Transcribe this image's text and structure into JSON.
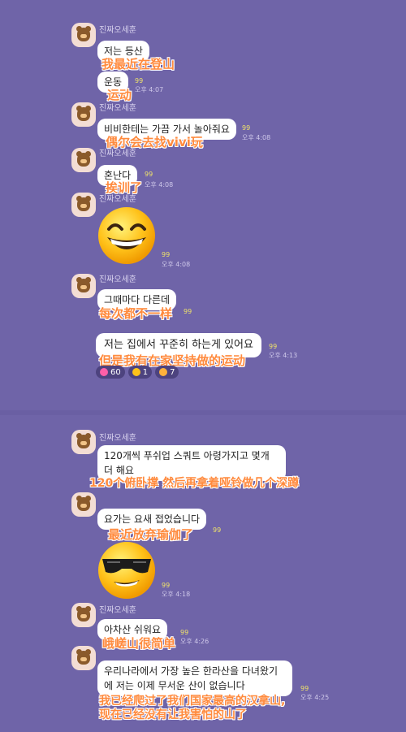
{
  "sender_name": "진짜오세훈",
  "read_mark": "99",
  "messages": [
    {
      "text": "저는 등산",
      "caption": "我最近在登山"
    },
    {
      "text": "운동",
      "time": "오후 4:07",
      "caption": "运动"
    },
    {
      "text": "비비한테는 가끔 가서 놀아줘요",
      "time": "오후 4:08",
      "caption": "偶尔会去找vivi玩"
    },
    {
      "text": "혼난다",
      "time": "오후 4:08",
      "caption": "挨训了"
    },
    {
      "emoji": "grinning-face",
      "time": "오후 4:08"
    },
    {
      "text": "그때마다 다른데",
      "caption": "每次都不一样"
    },
    {
      "text": "저는 집에서 꾸준히 하는게 있어요",
      "time": "오후 4:13",
      "caption": "但是我有在家坚持做的运动"
    },
    {
      "text": "120개씩 푸쉬업 스쿼트 아령가지고 몇개 더 해요",
      "caption": "120个俯卧撑 然后再拿着哑铃做几个深蹲"
    },
    {
      "text": "요가는 요새 접었습니다",
      "caption": "最近放弃瑜伽了"
    },
    {
      "emoji": "sunglasses-face",
      "time": "오후 4:18"
    },
    {
      "text": "아차산 쉬워요",
      "time": "오후 4:26",
      "caption": "峨嵯山很简单"
    },
    {
      "text": "우리나라에서 가장 높은 한라산을 다녀왔기에 저는 이제 무서운 산이 없습니다",
      "time": "오후 4:25",
      "caption": "我已经爬过了我们国家最高的汉拿山,\n现在已经没有让我害怕的山了"
    }
  ],
  "reactions": [
    {
      "icon": "heart-icon",
      "count": "60"
    },
    {
      "icon": "laugh-icon",
      "count": "1"
    },
    {
      "icon": "surprised-icon",
      "count": "7"
    }
  ],
  "colors": {
    "background": "#6f64a8",
    "caption": "#ff8a3d",
    "read_mark": "#f0e36a"
  }
}
